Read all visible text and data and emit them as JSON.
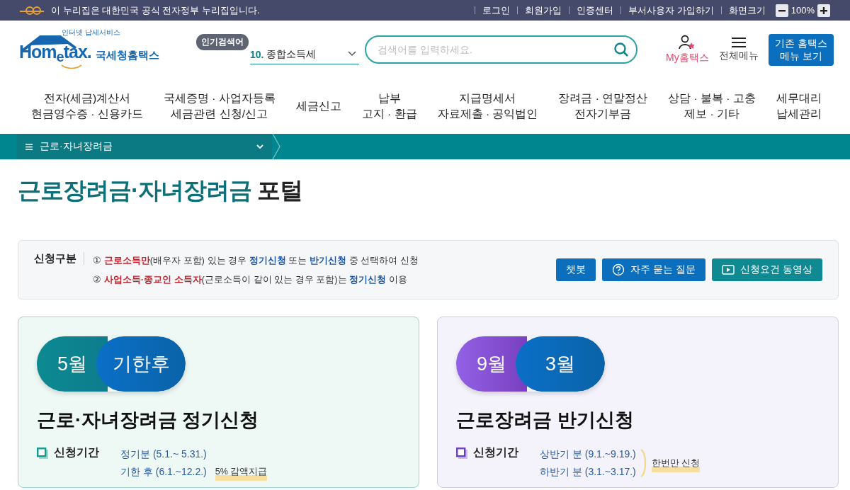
{
  "gov_banner": {
    "text": "이 누리집은 대한민국 공식 전자정부 누리집입니다.",
    "links": [
      "로그인",
      "회원가입",
      "인증센터",
      "부서사용자 가입하기",
      "화면크기"
    ],
    "zoom": "100%"
  },
  "header": {
    "logo_tagline": "인터넷 납세서비스",
    "logo_word": "Hom$_{e}$tax.",
    "logo_name": "국세청홈택스",
    "popular_badge": "인기검색어",
    "popular_rank": "10.",
    "popular_term": "종합소득세",
    "search_placeholder": "검색어를 입력하세요.",
    "my_menu": "My홈택스",
    "all_menu": "전체메뉴",
    "legacy_button": "기존 홈택스 메뉴 보기"
  },
  "nav": [
    {
      "lines": [
        "전자(세금)계산서",
        "현금영수증 · 신용카드"
      ]
    },
    {
      "lines": [
        "국세증명 · 사업자등록",
        "세금관련 신청/신고"
      ]
    },
    {
      "lines": [
        "세금신고"
      ]
    },
    {
      "lines": [
        "납부",
        "고지 · 환급"
      ]
    },
    {
      "lines": [
        "지급명세서",
        "자료제출 · 공익법인"
      ]
    },
    {
      "lines": [
        "장려금 · 연말정산",
        "전자기부금"
      ]
    },
    {
      "lines": [
        "상담 · 불복 · 고충",
        "제보 · 기타"
      ]
    },
    {
      "lines": [
        "세무대리",
        "납세관리"
      ]
    }
  ],
  "breadcrumb": "근로·자녀장려금",
  "page_title": {
    "accent": "근로장려금·자녀장려금",
    "rest": "포털"
  },
  "notice": {
    "label": "신청구분",
    "lines": [
      {
        "mark": "①",
        "parts": [
          {
            "text": "근로소득만",
            "color": "#c8202a"
          },
          {
            "text": "(배우자 포함) 있는 경우 "
          },
          {
            "text": "정기신청",
            "color": "#1b56a8"
          },
          {
            "text": " 또는 "
          },
          {
            "text": "반기신청",
            "color": "#1b56a8"
          },
          {
            "text": " 중 선택하여 신청"
          }
        ]
      },
      {
        "mark": "②",
        "parts": [
          {
            "text": "사업소득·종교인 소득자",
            "color": "#c8202a"
          },
          {
            "text": "(근로소득이 같이 있는 경우 포함)는 "
          },
          {
            "text": "정기신청",
            "color": "#1b56a8"
          },
          {
            "text": " 이용"
          }
        ]
      }
    ],
    "buttons": [
      {
        "label": "챗봇",
        "kind": "chat"
      },
      {
        "label": "자주 묻는 질문",
        "kind": "faq"
      },
      {
        "label": "신청요건 동영상",
        "kind": "video"
      }
    ]
  },
  "cards": [
    {
      "kind": "regular",
      "pills": [
        "5월",
        "기한후"
      ],
      "title": "근로·자녀장려금 정기신청",
      "period_label": "신청기간",
      "periods": [
        "정기분 (5.1.~ 5.31.)",
        "기한 후 (6.1.~12.2.)"
      ],
      "note": "5% 감액지급"
    },
    {
      "kind": "semiannual",
      "pills": [
        "9월",
        "3월"
      ],
      "title": "근로장려금 반기신청",
      "period_label": "신청기간",
      "periods": [
        "상반기 분 (9.1.~9.19.)",
        "하반기 분 (3.1.~3.17.)"
      ],
      "note": "한번만 신청"
    }
  ]
}
